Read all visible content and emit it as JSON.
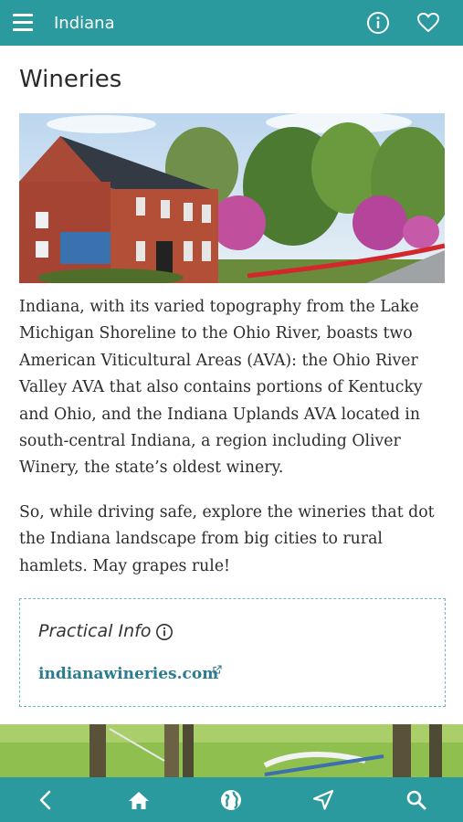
{
  "header": {
    "title": "Indiana",
    "icons": [
      "menu-icon",
      "info-icon",
      "heart-icon"
    ]
  },
  "page": {
    "title": "Wineries",
    "paragraphs": [
      "Indiana, with its varied topography from the Lake Michigan Shoreline to the Ohio River, boasts two American Viticultural Areas (AVA): the Ohio River Valley AVA that also contains portions of Kentucky and Ohio, and the Indiana Uplands AVA located in south-central Indiana, a region including Oliver Winery, the state’s oldest winery.",
      "So, while driving safe, explore the wineries that dot the Indiana landscape from big cities to rural hamlets. May grapes rule!"
    ]
  },
  "practical_info": {
    "title": "Practical Info",
    "link": "indianawineries.com"
  },
  "bottom_nav": {
    "icons": [
      "back-icon",
      "home-icon",
      "globe-icon",
      "navigate-icon",
      "search-icon"
    ]
  },
  "colors": {
    "accent": "#2b9a9e",
    "link": "#2b7c8f",
    "border": "#6fb7c4"
  }
}
